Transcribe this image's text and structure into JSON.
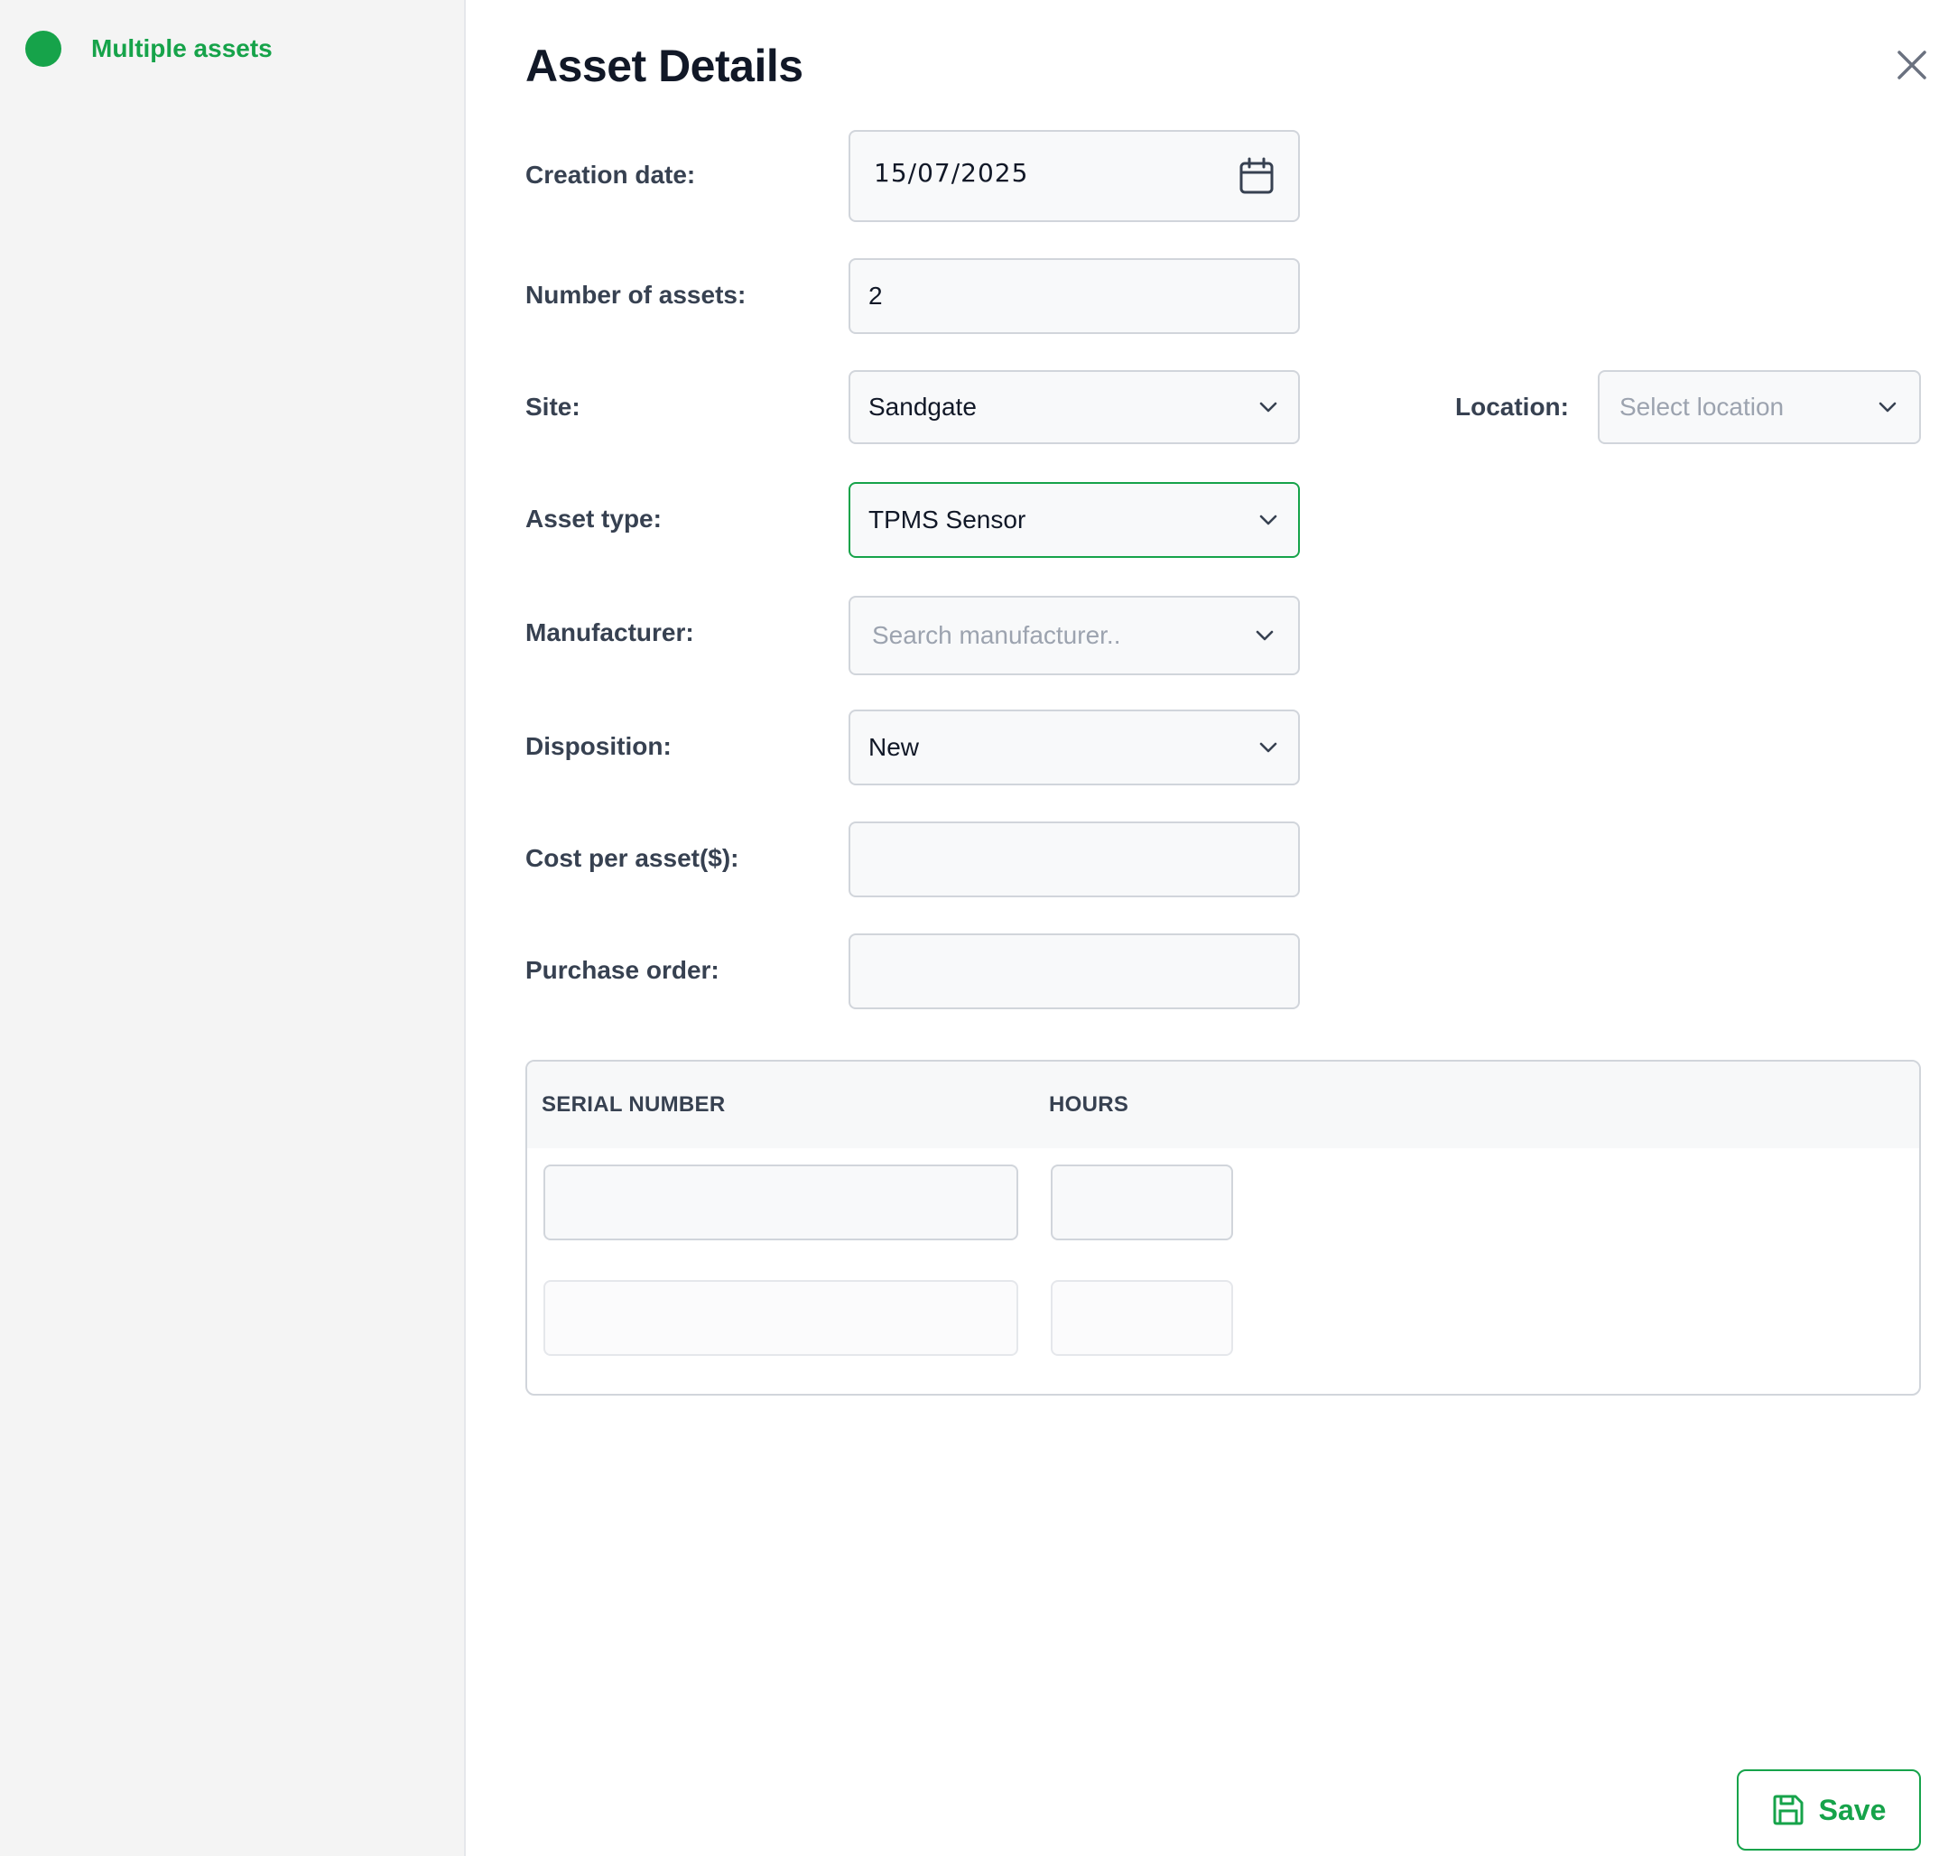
{
  "sidebar": {
    "item_label": "Multiple assets",
    "accent_color": "#16a34a"
  },
  "form": {
    "title": "Asset Details",
    "creation_date": {
      "label": "Creation date:",
      "value": "15/07/2025"
    },
    "number_of_assets": {
      "label": "Number of assets:",
      "value": "2"
    },
    "site": {
      "label": "Site:",
      "value": "Sandgate"
    },
    "location": {
      "label": "Location:",
      "placeholder": "Select location"
    },
    "asset_type": {
      "label": "Asset type:",
      "value": "TPMS Sensor"
    },
    "manufacturer": {
      "label": "Manufacturer:",
      "placeholder": "Search manufacturer.."
    },
    "disposition": {
      "label": "Disposition:",
      "value": "New"
    },
    "cost_per_asset": {
      "label": "Cost per asset($):",
      "value": ""
    },
    "purchase_order": {
      "label": "Purchase order:",
      "value": ""
    }
  },
  "table": {
    "headers": [
      "SERIAL NUMBER",
      "HOURS"
    ],
    "rows": [
      {
        "serial_number": "",
        "hours": ""
      },
      {
        "serial_number": "",
        "hours": ""
      }
    ]
  },
  "actions": {
    "save_label": "Save"
  },
  "icons": {
    "calendar": "calendar-icon",
    "chevron": "chevron-down-icon",
    "close": "close-icon",
    "save": "save-icon"
  }
}
